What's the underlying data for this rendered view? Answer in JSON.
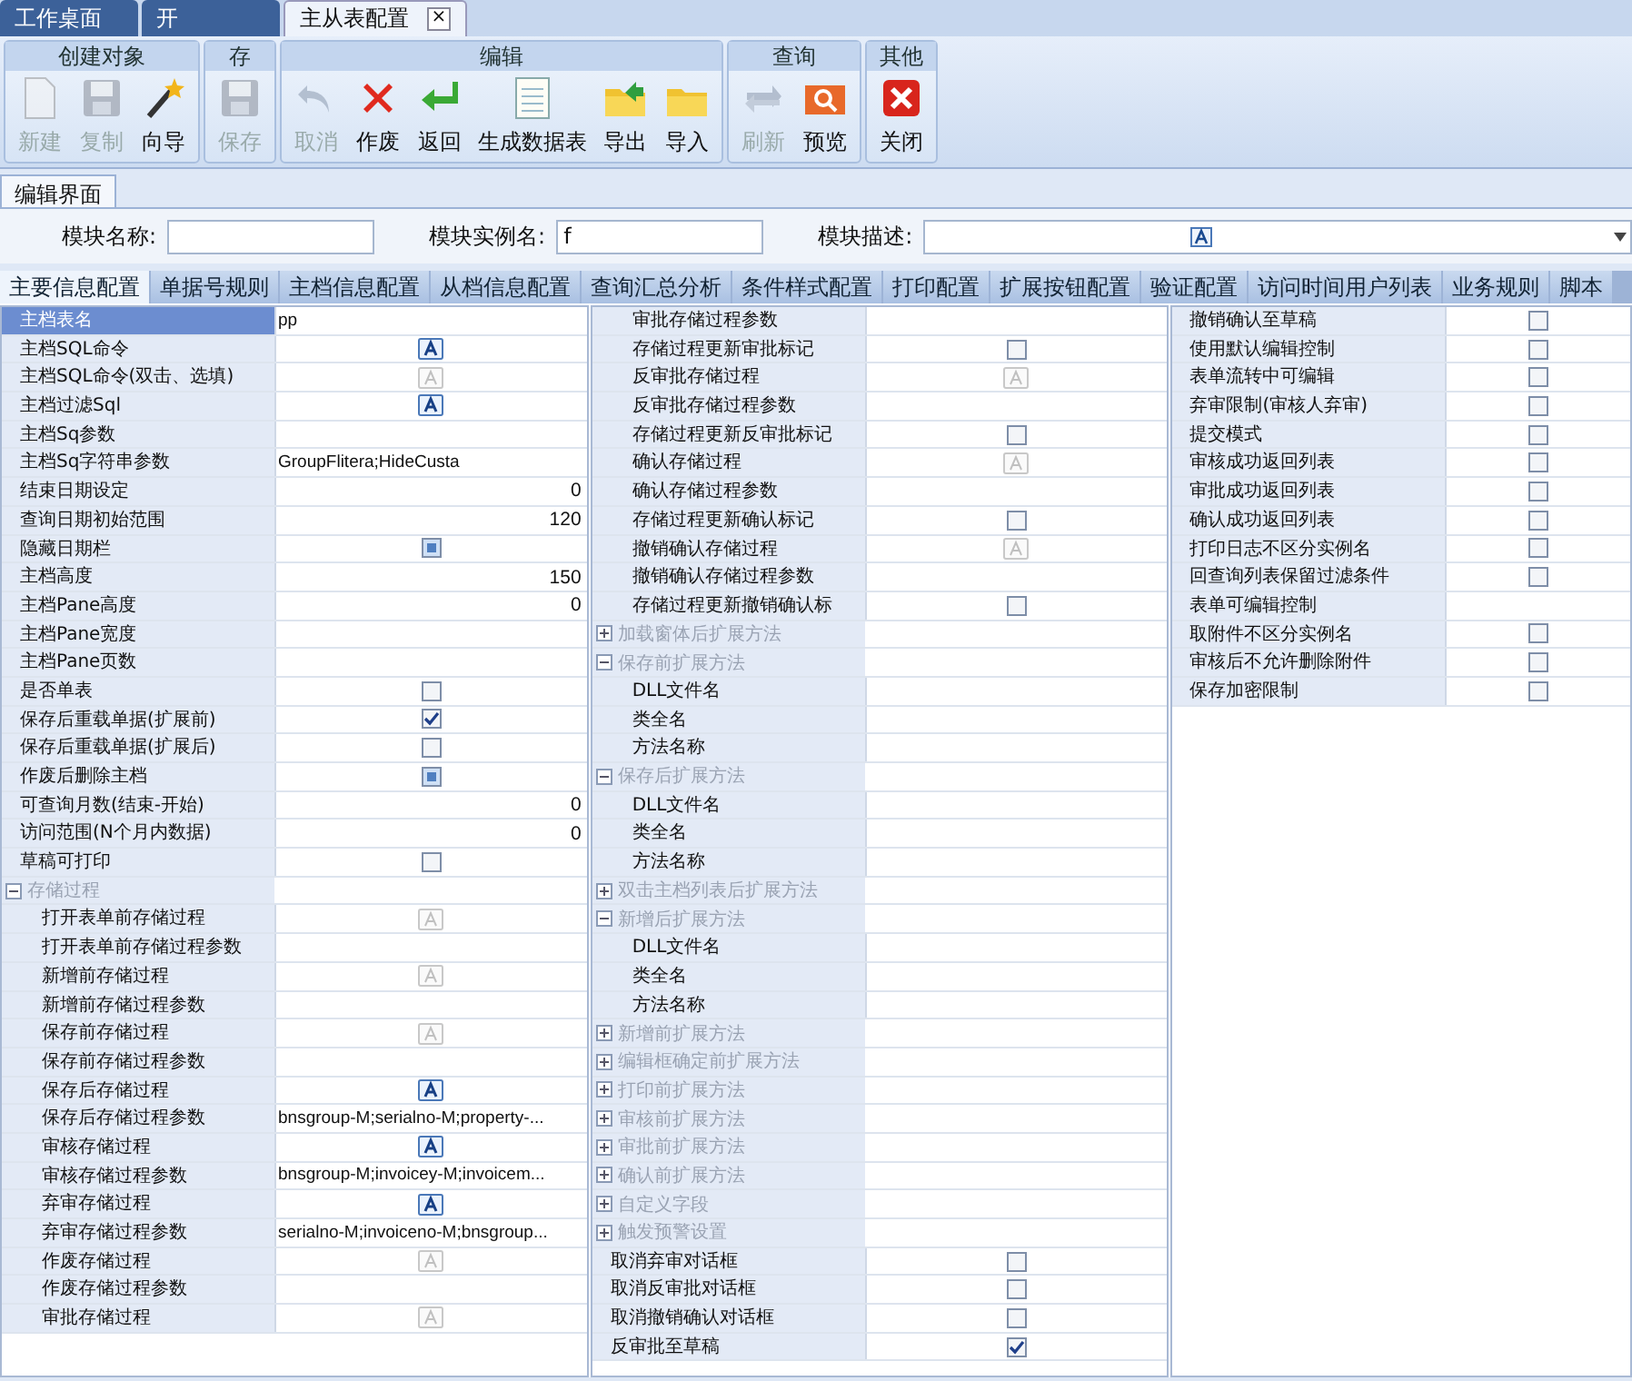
{
  "doc_tabs": [
    {
      "label": "工作桌面",
      "selected": false
    },
    {
      "label": "开",
      "selected": false
    },
    {
      "label": "主从表配置",
      "selected": true,
      "close": "×"
    }
  ],
  "toolbar": {
    "groups": [
      {
        "title": "创建对象",
        "buttons": [
          {
            "label": "新建",
            "kind": "new",
            "disabled": true
          },
          {
            "label": "复制",
            "kind": "copy",
            "disabled": true
          },
          {
            "label": "向导",
            "kind": "wand",
            "disabled": false
          }
        ]
      },
      {
        "title": "存",
        "buttons": [
          {
            "label": "保存",
            "kind": "save",
            "disabled": true
          }
        ]
      },
      {
        "title": "编辑",
        "buttons": [
          {
            "label": "取消",
            "kind": "undo",
            "disabled": true
          },
          {
            "label": "作废",
            "kind": "cross",
            "disabled": false
          },
          {
            "label": "返回",
            "kind": "enter",
            "disabled": false
          },
          {
            "label": "生成数据表",
            "kind": "sheet",
            "disabled": false
          },
          {
            "label": "导出",
            "kind": "export",
            "disabled": false
          },
          {
            "label": "导入",
            "kind": "folder",
            "disabled": false
          }
        ]
      },
      {
        "title": "查询",
        "buttons": [
          {
            "label": "刷新",
            "kind": "refresh",
            "disabled": true
          },
          {
            "label": "预览",
            "kind": "preview",
            "disabled": false
          }
        ]
      },
      {
        "title": "其他",
        "buttons": [
          {
            "label": "关闭",
            "kind": "close",
            "disabled": false
          }
        ]
      }
    ]
  },
  "sub_tab": "编辑界面",
  "fields": [
    {
      "label": "模块名称:"
    },
    {
      "label": "模块实例名:",
      "value": "f"
    },
    {
      "label": "模块描述:",
      "editor": true,
      "dropdown": true
    }
  ],
  "tabs": [
    {
      "label": "主要信息配置",
      "selected": true
    },
    {
      "label": "单据号规则",
      "selected": false
    },
    {
      "label": "主档信息配置",
      "selected": false
    },
    {
      "label": "从档信息配置",
      "selected": false
    },
    {
      "label": "查询汇总分析",
      "selected": false
    },
    {
      "label": "条件样式配置",
      "selected": false
    },
    {
      "label": "打印配置",
      "selected": false
    },
    {
      "label": "扩展按钮配置",
      "selected": false
    },
    {
      "label": "验证配置",
      "selected": false
    },
    {
      "label": "访问时间用户列表",
      "selected": false
    },
    {
      "label": "业务规则",
      "selected": false
    },
    {
      "label": "脚本",
      "selected": false
    }
  ],
  "property_grid": {
    "columns": [
      {
        "rows": [
          {
            "label": "主档表名",
            "kind": "text",
            "value": "pp",
            "selected": true
          },
          {
            "label": "主档SQL命令",
            "kind": "editor",
            "enabled": true
          },
          {
            "label": "主档SQL命令(双击、选填)",
            "kind": "editor",
            "enabled": false
          },
          {
            "label": "主档过滤Sql",
            "kind": "editor",
            "enabled": true
          },
          {
            "label": "主档Sq参数",
            "kind": "blank"
          },
          {
            "label": "主档Sq字符串参数",
            "kind": "text",
            "value": "GroupFlitera;HideCusta"
          },
          {
            "label": "结束日期设定",
            "kind": "number",
            "value": "0"
          },
          {
            "label": "查询日期初始范围",
            "kind": "number",
            "value": "120"
          },
          {
            "label": "隐藏日期栏",
            "kind": "check",
            "indeterminate": true
          },
          {
            "label": "主档高度",
            "kind": "number",
            "value": "150"
          },
          {
            "label": "主档Pane高度",
            "kind": "number",
            "value": "0"
          },
          {
            "label": "主档Pane宽度",
            "kind": "blank"
          },
          {
            "label": "主档Pane页数",
            "kind": "blank"
          },
          {
            "label": "是否单表",
            "kind": "check",
            "checked": false,
            "indeterminate": false
          },
          {
            "label": "保存后重载单据(扩展前)",
            "kind": "check",
            "checked": true
          },
          {
            "label": "保存后重载单据(扩展后)",
            "kind": "check",
            "checked": false,
            "indeterminate": false
          },
          {
            "label": "作废后删除主档",
            "kind": "check",
            "indeterminate": true
          },
          {
            "label": "可查询月数(结束-开始)",
            "kind": "number",
            "value": "0"
          },
          {
            "label": "访问范围(N个月内数据)",
            "kind": "number",
            "value": "0"
          },
          {
            "label": "草稿可打印",
            "kind": "check",
            "checked": false,
            "indeterminate": false
          },
          {
            "label": "存储过程",
            "kind": "group",
            "expanded": true,
            "children": [
              {
                "label": "打开表单前存储过程",
                "kind": "editor",
                "enabled": false
              },
              {
                "label": "打开表单前存储过程参数",
                "kind": "blank"
              },
              {
                "label": "新增前存储过程",
                "kind": "editor",
                "enabled": false
              },
              {
                "label": "新增前存储过程参数",
                "kind": "blank"
              },
              {
                "label": "保存前存储过程",
                "kind": "editor",
                "enabled": false
              },
              {
                "label": "保存前存储过程参数",
                "kind": "blank"
              },
              {
                "label": "保存后存储过程",
                "kind": "editor",
                "enabled": true
              },
              {
                "label": "保存后存储过程参数",
                "kind": "text",
                "value": "bnsgroup-M;serialno-M;property-..."
              },
              {
                "label": "审核存储过程",
                "kind": "editor",
                "enabled": true
              },
              {
                "label": "审核存储过程参数",
                "kind": "text",
                "value": "bnsgroup-M;invoicey-M;invoicem..."
              },
              {
                "label": "弃审存储过程",
                "kind": "editor",
                "enabled": true
              },
              {
                "label": "弃审存储过程参数",
                "kind": "text",
                "value": "serialno-M;invoiceno-M;bnsgroup..."
              },
              {
                "label": "作废存储过程",
                "kind": "editor",
                "enabled": false
              },
              {
                "label": "作废存储过程参数",
                "kind": "blank"
              },
              {
                "label": "审批存储过程",
                "kind": "editor",
                "enabled": false
              }
            ]
          }
        ]
      },
      {
        "continued": [
          {
            "label": "审批存储过程参数",
            "kind": "blank"
          },
          {
            "label": "存储过程更新审批标记",
            "kind": "check",
            "checked": false,
            "indeterminate": false
          },
          {
            "label": "反审批存储过程",
            "kind": "editor",
            "enabled": false
          },
          {
            "label": "反审批存储过程参数",
            "kind": "blank"
          },
          {
            "label": "存储过程更新反审批标记",
            "kind": "check",
            "checked": false,
            "indeterminate": false
          },
          {
            "label": "确认存储过程",
            "kind": "editor",
            "enabled": false
          },
          {
            "label": "确认存储过程参数",
            "kind": "blank"
          },
          {
            "label": "存储过程更新确认标记",
            "kind": "check",
            "checked": false,
            "indeterminate": false
          },
          {
            "label": "撤销确认存储过程",
            "kind": "editor",
            "enabled": false
          },
          {
            "label": "撤销确认存储过程参数",
            "kind": "blank"
          },
          {
            "label": "存储过程更新撤销确认标",
            "kind": "check",
            "checked": false,
            "indeterminate": false
          }
        ],
        "rows": [
          {
            "label": "加载窗体后扩展方法",
            "kind": "group",
            "expanded": false
          },
          {
            "label": "保存前扩展方法",
            "kind": "group",
            "expanded": true,
            "children": [
              {
                "label": "DLL文件名",
                "kind": "blank"
              },
              {
                "label": "类全名",
                "kind": "blank"
              },
              {
                "label": "方法名称",
                "kind": "blank"
              }
            ]
          },
          {
            "label": "保存后扩展方法",
            "kind": "group",
            "expanded": true,
            "children": [
              {
                "label": "DLL文件名",
                "kind": "blank"
              },
              {
                "label": "类全名",
                "kind": "blank"
              },
              {
                "label": "方法名称",
                "kind": "blank"
              }
            ]
          },
          {
            "label": "双击主档列表后扩展方法",
            "kind": "group",
            "expanded": false
          },
          {
            "label": "新增后扩展方法",
            "kind": "group",
            "expanded": true,
            "children": [
              {
                "label": "DLL文件名",
                "kind": "blank"
              },
              {
                "label": "类全名",
                "kind": "blank"
              },
              {
                "label": "方法名称",
                "kind": "blank"
              }
            ]
          },
          {
            "label": "新增前扩展方法",
            "kind": "group",
            "expanded": false
          },
          {
            "label": "编辑框确定前扩展方法",
            "kind": "group",
            "expanded": false
          },
          {
            "label": "打印前扩展方法",
            "kind": "group",
            "expanded": false
          },
          {
            "label": "审核前扩展方法",
            "kind": "group",
            "expanded": false
          },
          {
            "label": "审批前扩展方法",
            "kind": "group",
            "expanded": false
          },
          {
            "label": "确认前扩展方法",
            "kind": "group",
            "expanded": false
          },
          {
            "label": "自定义字段",
            "kind": "group",
            "expanded": false
          },
          {
            "label": "触发预警设置",
            "kind": "group",
            "expanded": false
          },
          {
            "label": "取消弃审对话框",
            "kind": "check",
            "checked": false,
            "indeterminate": false
          },
          {
            "label": "取消反审批对话框",
            "kind": "check",
            "checked": false,
            "indeterminate": false
          },
          {
            "label": "取消撤销确认对话框",
            "kind": "check",
            "checked": false,
            "indeterminate": false
          },
          {
            "label": "反审批至草稿",
            "kind": "check",
            "checked": true
          }
        ]
      },
      {
        "rows": [
          {
            "label": "撤销确认至草稿",
            "kind": "check",
            "checked": false,
            "indeterminate": false
          },
          {
            "label": "使用默认编辑控制",
            "kind": "check",
            "checked": false,
            "indeterminate": false
          },
          {
            "label": "表单流转中可编辑",
            "kind": "check",
            "checked": false,
            "indeterminate": false
          },
          {
            "label": "弃审限制(审核人弃审)",
            "kind": "check",
            "checked": false,
            "indeterminate": false
          },
          {
            "label": "提交模式",
            "kind": "check",
            "checked": false,
            "indeterminate": false
          },
          {
            "label": "审核成功返回列表",
            "kind": "check",
            "checked": false,
            "indeterminate": false
          },
          {
            "label": "审批成功返回列表",
            "kind": "check",
            "checked": false,
            "indeterminate": false
          },
          {
            "label": "确认成功返回列表",
            "kind": "check",
            "checked": false,
            "indeterminate": false
          },
          {
            "label": "打印日志不区分实例名",
            "kind": "check",
            "checked": false,
            "indeterminate": false
          },
          {
            "label": "回查询列表保留过滤条件",
            "kind": "check",
            "checked": false,
            "indeterminate": false
          },
          {
            "label": "表单可编辑控制",
            "kind": "blank"
          },
          {
            "label": "取附件不区分实例名",
            "kind": "check",
            "checked": false,
            "indeterminate": false
          },
          {
            "label": "审核后不允许删除附件",
            "kind": "check",
            "checked": false,
            "indeterminate": false
          },
          {
            "label": "保存加密限制",
            "kind": "check",
            "checked": false,
            "indeterminate": false
          }
        ]
      }
    ]
  }
}
